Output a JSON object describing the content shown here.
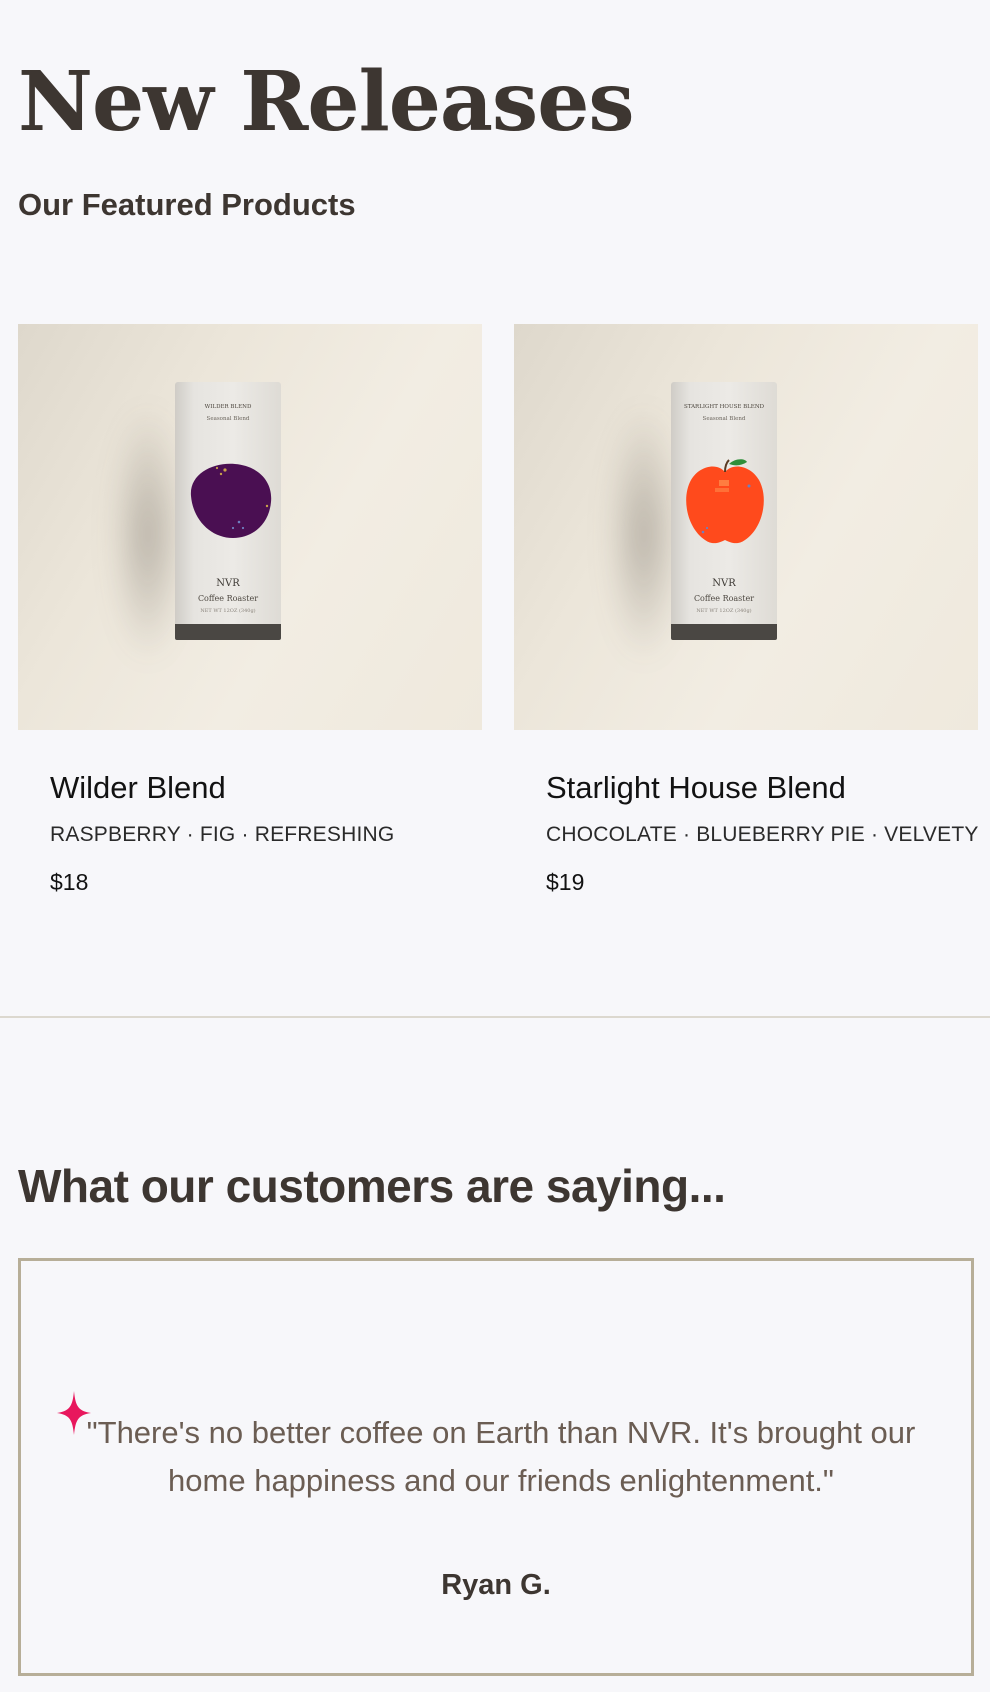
{
  "header": {
    "title": "New Releases",
    "subtitle": "Our Featured Products"
  },
  "products": [
    {
      "name": "Wilder Blend",
      "notes": "RASPBERRY · FIG · REFRESHING",
      "price": "$18",
      "bag": {
        "label": "WILDER BLEND",
        "kind": "Seasonal Blend",
        "brand": "NVR",
        "roaster": "Coffee Roaster",
        "weight": "NET WT 12OZ (340g)",
        "art": "purple-plum-shape",
        "art_color": "#4a0f52"
      }
    },
    {
      "name": "Starlight House Blend",
      "notes": "CHOCOLATE · BLUEBERRY PIE · VELVETY",
      "price": "$19",
      "bag": {
        "label": "STARLIGHT HOUSE BLEND",
        "kind": "Seasonal Blend",
        "brand": "NVR",
        "roaster": "Coffee Roaster",
        "weight": "NET WT 12OZ (340g)",
        "art": "orange-apple-shape",
        "art_color": "#ff4a1c"
      }
    }
  ],
  "testimonials": {
    "heading": "What our customers are saying...",
    "quote": "\"There's no better coffee on Earth than NVR. It's brought our home happiness and our friends enlightenment.\"",
    "author": "Ryan G.",
    "sparkle_icon": "sparkle-icon",
    "sparkle_color": "#e8175d"
  },
  "colors": {
    "background": "#f7f7fa",
    "heading": "#3d3631",
    "quote": "#6b5d53",
    "border": "#b7ae98",
    "divider": "#dcd8cf"
  }
}
